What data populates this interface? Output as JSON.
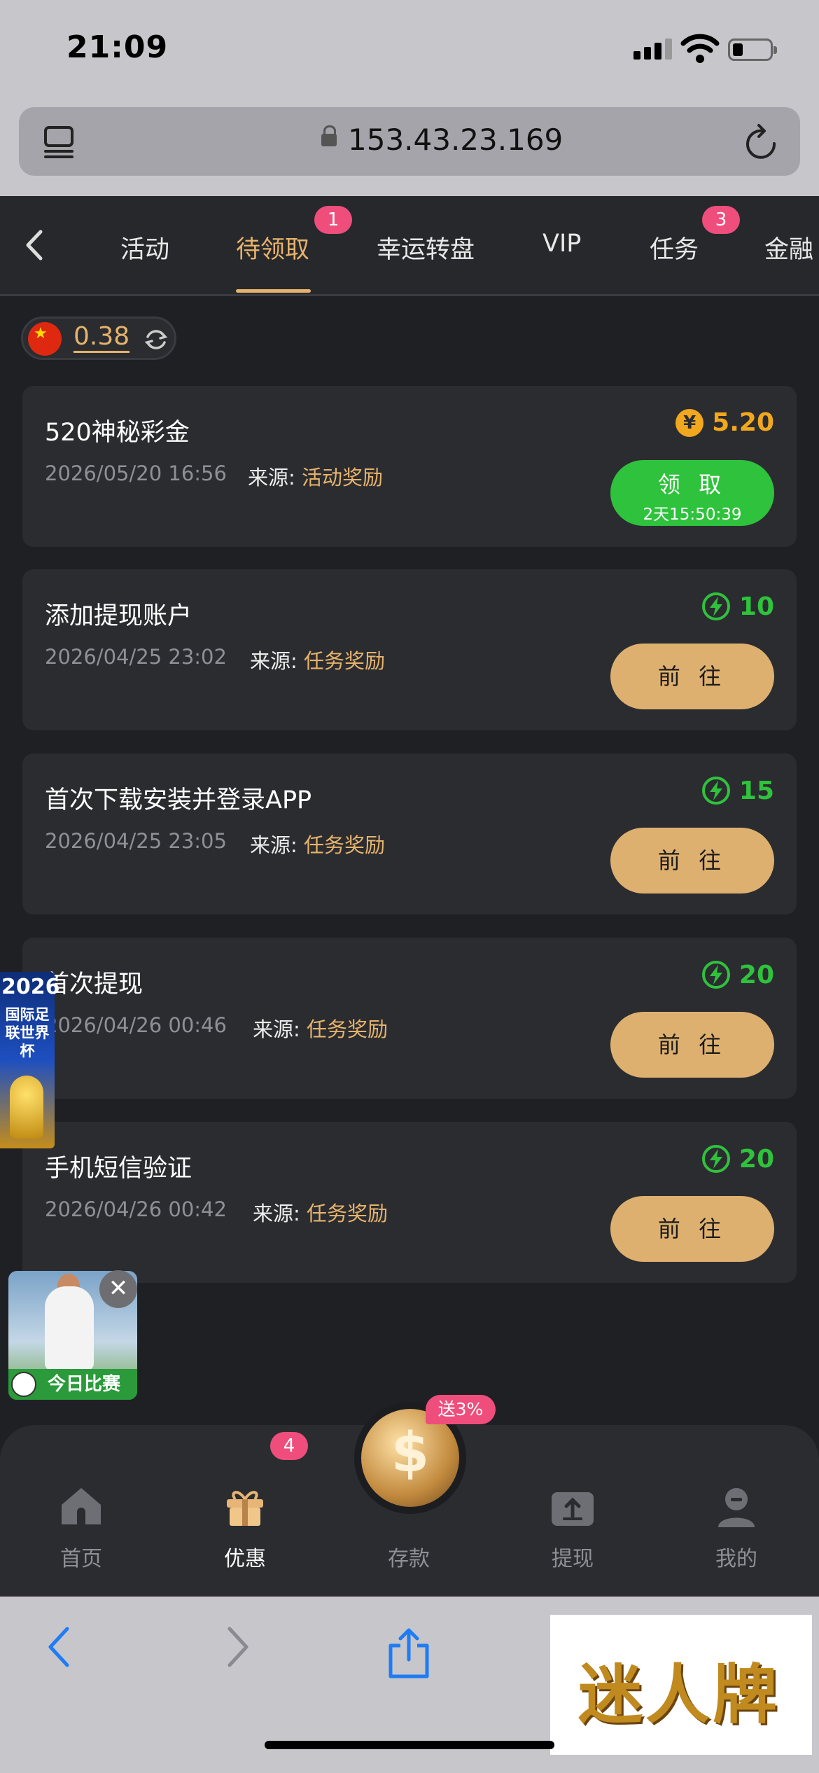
{
  "status_bar": {
    "time": "21:09"
  },
  "browser": {
    "url": "153.43.23.169"
  },
  "nav": {
    "tabs": [
      {
        "label": "活动",
        "active": false
      },
      {
        "label": "待领取",
        "active": true,
        "badge": "1"
      },
      {
        "label": "幸运转盘",
        "active": false
      },
      {
        "label": "VIP",
        "active": false
      },
      {
        "label": "任务",
        "active": false,
        "badge": "3"
      },
      {
        "label": "金融",
        "active": false
      }
    ]
  },
  "balance": {
    "value": "0.38"
  },
  "source_label": "来源: ",
  "cards": [
    {
      "title": "520神秘彩金",
      "date": "2026/05/20 16:56",
      "source": "活动奖励",
      "reward": "5.20",
      "reward_type": "coin",
      "button": "领 取",
      "countdown": "2天15:50:39"
    },
    {
      "title": "添加提现账户",
      "date": "2026/04/25 23:02",
      "source": "任务奖励",
      "reward": "10",
      "reward_type": "bolt",
      "button": "前 往"
    },
    {
      "title": "首次下载安装并登录APP",
      "date": "2026/04/25 23:05",
      "source": "任务奖励",
      "reward": "15",
      "reward_type": "bolt",
      "button": "前 往"
    },
    {
      "title": "首次提现",
      "date": "2026/04/26 00:46",
      "source": "任务奖励",
      "reward": "20",
      "reward_type": "bolt",
      "button": "前 往"
    },
    {
      "title": "手机短信验证",
      "date": "2026/04/26 00:42",
      "source": "任务奖励",
      "reward": "20",
      "reward_type": "bolt",
      "button": "前 往"
    }
  ],
  "ads": {
    "worldcup": {
      "year": "2026",
      "text": "国际足联世界杯"
    },
    "match": {
      "label": "今日比赛"
    }
  },
  "tabbar": {
    "items": [
      {
        "label": "首页",
        "icon": "home-icon"
      },
      {
        "label": "优惠",
        "icon": "gift-icon",
        "badge": "4",
        "active": true
      },
      {
        "label": "存款",
        "icon": "deposit-icon",
        "badge": "送3%"
      },
      {
        "label": "提现",
        "icon": "withdraw-icon"
      },
      {
        "label": "我的",
        "icon": "profile-icon"
      }
    ]
  },
  "watermark": {
    "text": "迷人牌"
  },
  "colors": {
    "accent": "#e6b36c",
    "green": "#2fc23c",
    "badge": "#ef4e7d",
    "card": "#2b2c30",
    "background": "#1f2024"
  }
}
